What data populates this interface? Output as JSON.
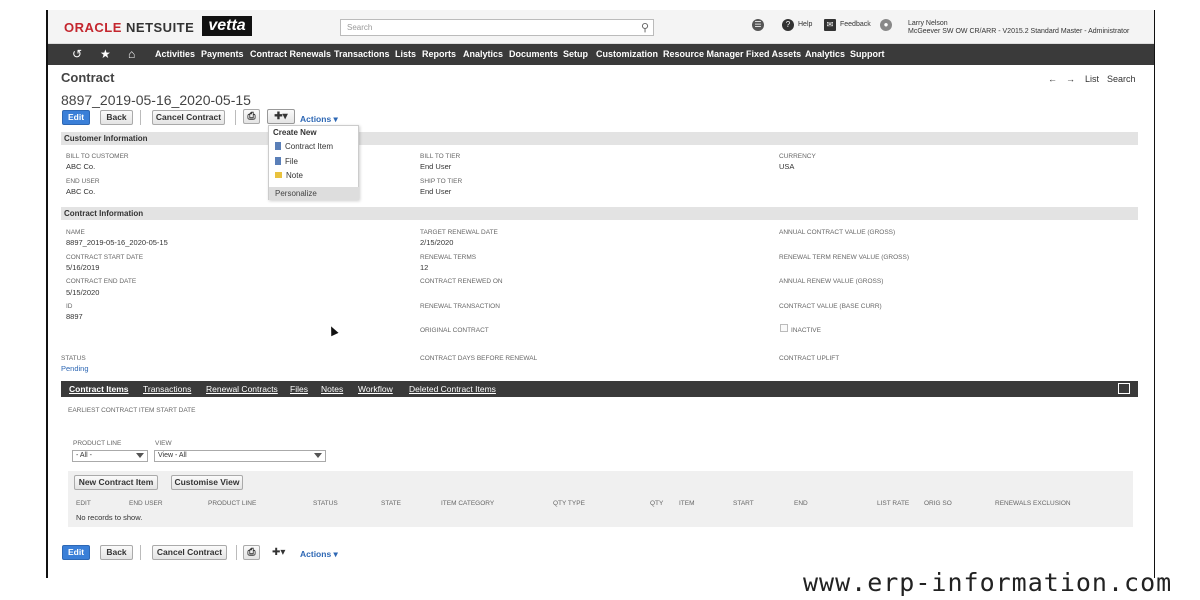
{
  "topbar": {
    "logo_oracle": "ORACLE",
    "logo_netsuite": "NETSUITE",
    "brand_logo": "vetta",
    "search_placeholder": "Search",
    "help": "Help",
    "feedback": "Feedback",
    "user_name": "Larry Nelson",
    "user_role": "McGeever SW OW CR/ARR - V2015.2 Standard Master - Administrator"
  },
  "nav": {
    "items": [
      "Activities",
      "Payments",
      "Contract Renewals",
      "Transactions",
      "Lists",
      "Reports",
      "Analytics",
      "Documents",
      "Setup",
      "Customization",
      "Resource Manager",
      "Fixed Assets",
      "Analytics",
      "Support"
    ]
  },
  "record": {
    "type": "Contract",
    "name": "8897_2019-05-16_2020-05-15",
    "list_link": "List",
    "search_link": "Search"
  },
  "toolbar": {
    "edit": "Edit",
    "back": "Back",
    "cancel_contract": "Cancel Contract",
    "actions": "Actions"
  },
  "new_menu": {
    "header": "Create New",
    "items": [
      "Contract Item",
      "File",
      "Note"
    ],
    "personalize": "Personalize"
  },
  "customer_section": {
    "title": "Customer Information",
    "bill_to_customer_label": "BILL TO CUSTOMER",
    "bill_to_customer": "ABC Co.",
    "end_user_label": "END USER",
    "end_user": "ABC Co.",
    "bill_to_tier_label": "BILL TO TIER",
    "bill_to_tier": "End User",
    "ship_to_tier_label": "SHIP TO TIER",
    "ship_to_tier": "End User",
    "currency_label": "CURRENCY",
    "currency": "USA"
  },
  "contract_section": {
    "title": "Contract Information",
    "name_label": "NAME",
    "name": "8897_2019-05-16_2020-05-15",
    "start_label": "CONTRACT START DATE",
    "start": "5/16/2019",
    "end_label": "CONTRACT END DATE",
    "end": "5/15/2020",
    "id_label": "ID",
    "id": "8897",
    "status_label": "STATUS",
    "status": "Pending",
    "target_label": "TARGET RENEWAL DATE",
    "target": "2/15/2020",
    "terms_label": "RENEWAL TERMS",
    "terms": "12",
    "renewed_on_label": "CONTRACT RENEWED ON",
    "renewal_tx_label": "RENEWAL TRANSACTION",
    "original_label": "ORIGINAL CONTRACT",
    "days_before_label": "CONTRACT DAYS BEFORE RENEWAL",
    "acv_label": "ANNUAL CONTRACT VALUE (GROSS)",
    "term_renew_label": "RENEWAL TERM RENEW VALUE (GROSS)",
    "annual_renew_label": "ANNUAL RENEW VALUE (GROSS)",
    "value_base_label": "CONTRACT VALUE (BASE CURR)",
    "inactive_label": "INACTIVE",
    "uplift_label": "CONTRACT UPLIFT"
  },
  "subtabs": [
    "Contract Items",
    "Transactions",
    "Renewal Contracts",
    "Files",
    "Notes",
    "Workflow",
    "Deleted Contract Items"
  ],
  "items_tab": {
    "earliest_label": "EARLIEST CONTRACT ITEM START DATE",
    "product_line_label": "PRODUCT LINE",
    "product_line_value": "- All -",
    "view_label": "VIEW",
    "view_value": "View - All",
    "new_item_button": "New Contract Item",
    "customise_view_button": "Customise View",
    "columns": [
      "EDIT",
      "END USER",
      "PRODUCT LINE",
      "STATUS",
      "STATE",
      "ITEM CATEGORY",
      "QTY TYPE",
      "QTY",
      "ITEM",
      "START",
      "END",
      "LIST RATE",
      "ORIG SO",
      "RENEWALS EXCLUSION"
    ],
    "empty_text": "No records to show."
  },
  "watermark": "www.erp-information.com"
}
